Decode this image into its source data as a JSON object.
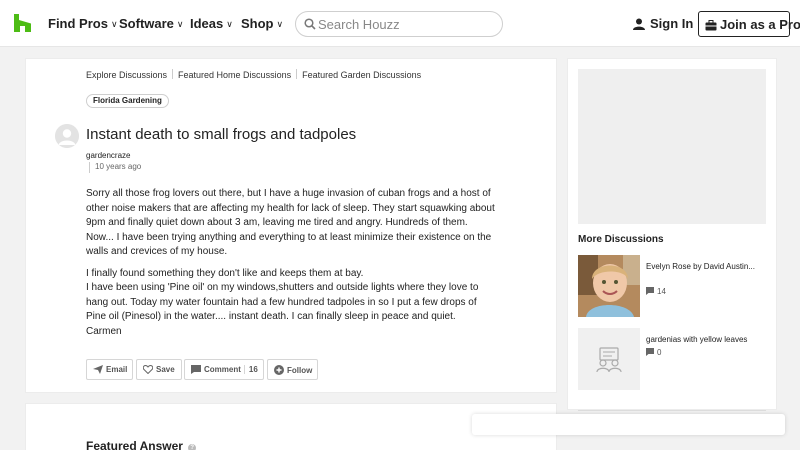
{
  "header": {
    "nav": [
      {
        "label": "Find Pros"
      },
      {
        "label": "Software"
      },
      {
        "label": "Ideas"
      },
      {
        "label": "Shop"
      }
    ],
    "search_placeholder": "Search Houzz",
    "signin_label": "Sign In",
    "join_label": "Join as a Pro",
    "brand_color": "#4dbc15"
  },
  "breadcrumbs": [
    "Explore Discussions",
    "Featured Home Discussions",
    "Featured Garden Discussions"
  ],
  "tag": "Florida Gardening",
  "post": {
    "title": "Instant death to small frogs and tadpoles",
    "author": "gardencraze",
    "time": "10 years ago",
    "paragraphs": [
      "Sorry all those frog lovers out there, but I have a huge invasion of cuban frogs and a host of other noise makers that are affecting my health for lack of sleep. They start squawking about 9pm and finally quiet down about 3 am, leaving me tired and angry. Hundreds of them. Now... I have been trying anything and everything to at least minimize their existence on the walls and crevices of my house.",
      "I finally found something they don't like and keeps them at bay.",
      "I have been using 'Pine oil' on my windows,shutters and outside lights where they love to hang out. Today my water fountain had a few hundred tadpoles in so I put a few drops of Pine oil (Pinesol) in the water.... instant death. I can finally sleep in peace and quiet.",
      "Carmen"
    ]
  },
  "actions": {
    "email": "Email",
    "save": "Save",
    "comment": "Comment",
    "comment_count": "16",
    "follow": "Follow"
  },
  "featured_answer": "Featured Answer",
  "sidebar": {
    "more_title": "More Discussions",
    "discussions": [
      {
        "title": "Evelyn Rose by David Austin...",
        "count": "14",
        "thumb": "photo-thumbnail"
      },
      {
        "title": "gardenias with yellow leaves",
        "count": "0",
        "thumb": "placeholder-people-icon"
      }
    ]
  }
}
